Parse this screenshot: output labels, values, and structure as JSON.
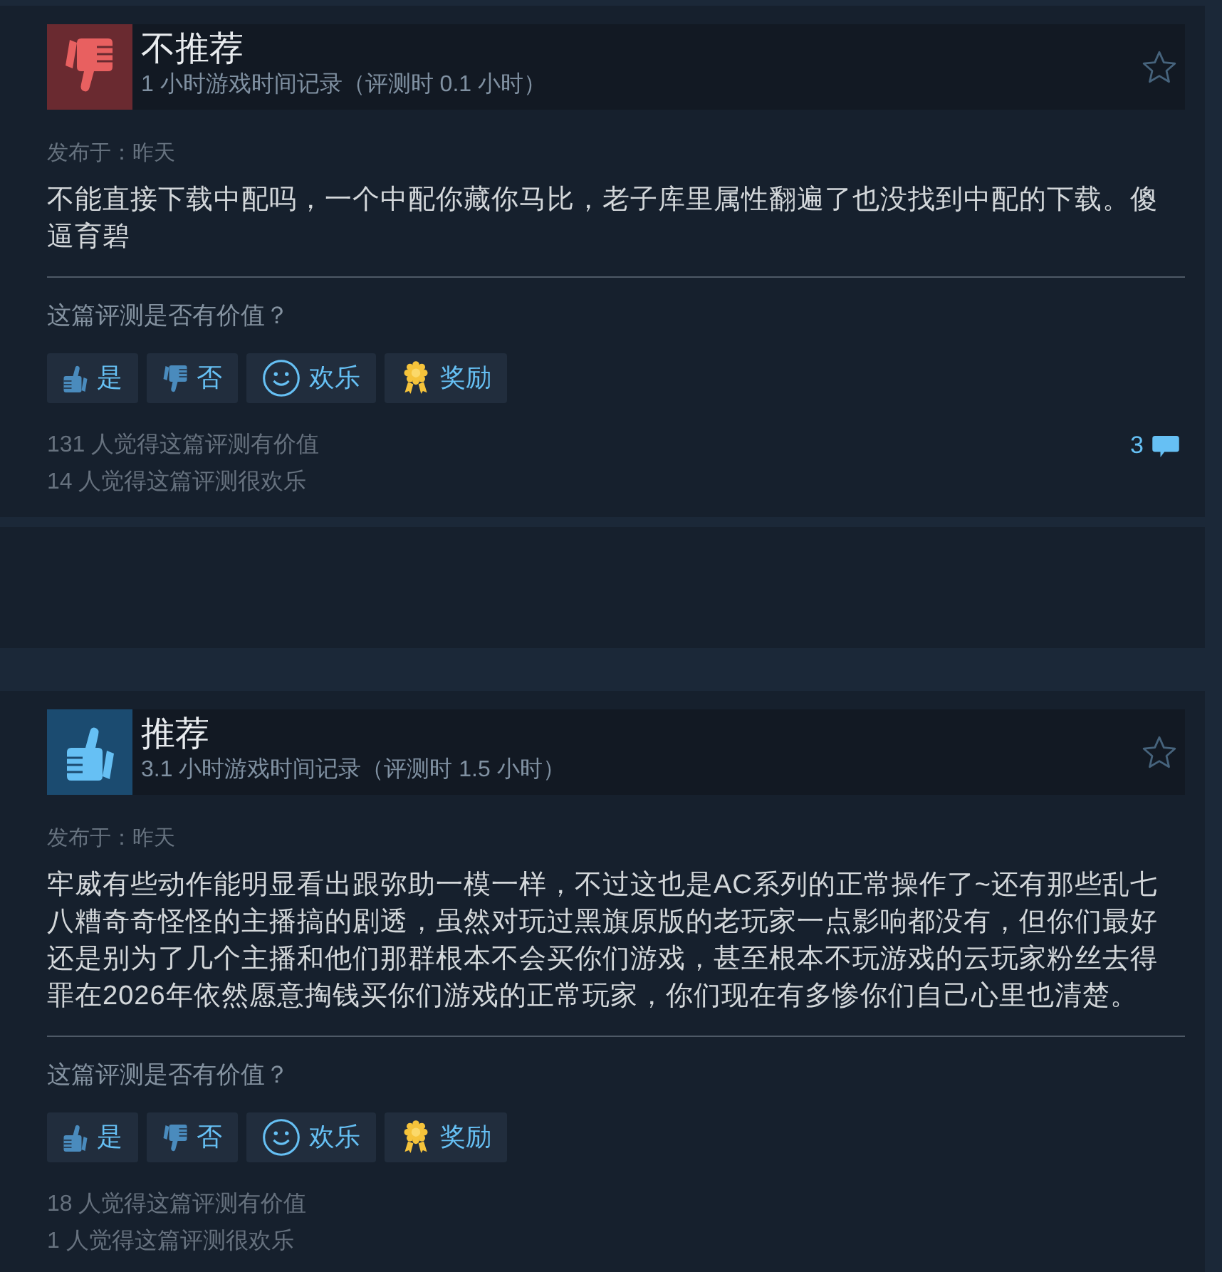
{
  "feed": [
    {
      "kind": "review",
      "recommended": false,
      "verdict": "不推荐",
      "playtime": "1 小时游戏时间记录（评测时 0.1 小时）",
      "posted": "发布于：昨天",
      "text": "不能直接下载中配吗，一个中配你藏你马比，老子库里属性翻遍了也没找到中配的下载。傻逼育碧",
      "question": "这篇评测是否有价值？",
      "vote_buttons": [
        {
          "kind": "yes",
          "label": "是"
        },
        {
          "kind": "no",
          "label": "否"
        },
        {
          "kind": "funny",
          "label": "欢乐"
        },
        {
          "kind": "award",
          "label": "奖励"
        }
      ],
      "vote_summary": [
        "131 人觉得这篇评测有价值",
        "14 人觉得这篇评测很欢乐"
      ],
      "comments": "3"
    },
    {
      "kind": "blank"
    },
    {
      "kind": "review",
      "recommended": true,
      "verdict": "推荐",
      "playtime": "3.1 小时游戏时间记录（评测时 1.5 小时）",
      "posted": "发布于：昨天",
      "text": "牢威有些动作能明显看出跟弥助一模一样，不过这也是AC系列的正常操作了~还有那些乱七八糟奇奇怪怪的主播搞的剧透，虽然对玩过黑旗原版的老玩家一点影响都没有，但你们最好还是别为了几个主播和他们那群根本不会买你们游戏，甚至根本不玩游戏的云玩家粉丝去得罪在2026年依然愿意掏钱买你们游戏的正常玩家，你们现在有多惨你们自己心里也清楚。",
      "question": "这篇评测是否有价值？",
      "vote_buttons": [
        {
          "kind": "yes",
          "label": "是"
        },
        {
          "kind": "no",
          "label": "否"
        },
        {
          "kind": "funny",
          "label": "欢乐"
        },
        {
          "kind": "award",
          "label": "奖励"
        }
      ],
      "vote_summary": [
        "18 人觉得这篇评测有价值",
        "1 人觉得这篇评测很欢乐"
      ]
    }
  ]
}
